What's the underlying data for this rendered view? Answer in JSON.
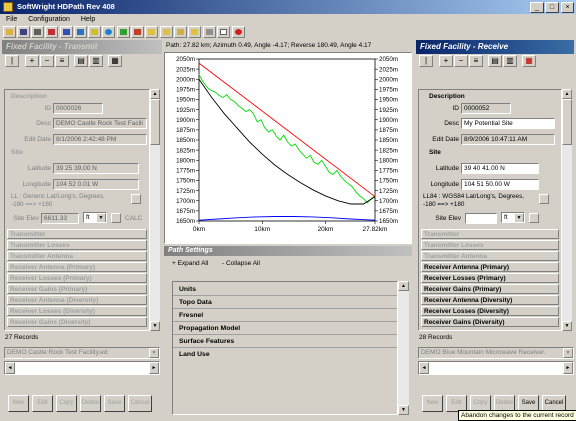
{
  "window": {
    "title": "SoftWright HDPath Rev 408"
  },
  "menu": [
    "File",
    "Configuration",
    "Help"
  ],
  "path_info": "Path: 27.82 km; Azimuth 0.49, Angle -4.17; Reverse 180.49, Angle 4.17",
  "left_panel": {
    "header": "Fixed Facility - Transmit",
    "description_label": "Description",
    "id_label": "ID",
    "id_value": "0000026",
    "desc_label": "Desc",
    "desc_value": "DEMO Castle Rock Test Facili",
    "edit_date_label": "Edit Date",
    "edit_date_value": "8/1/2006 2:42:48 PM",
    "site_label": "Site",
    "latitude_label": "Latitude",
    "latitude_value": "39 25 39.00 N",
    "longitude_label": "Longitude",
    "longitude_value": "104 52 0.01 W",
    "datum_text_1": "LL : Generic Lat/Long's, Degrees,",
    "datum_text_2": "-180 ==> +180",
    "site_elev_label": "Site Elev",
    "site_elev_value": "6611.33",
    "elev_unit": "ft",
    "calc_label": "CALC",
    "sections": [
      "Transmitter",
      "Transmitter Losses",
      "Transmitter Antenna",
      "Receiver Antenna (Primary)",
      "Receiver Losses (Primary)",
      "Receiver Gains (Primary)",
      "Receiver Antenna (Diversity)",
      "Receiver Losses (Diversity)",
      "Receiver Gains (Diversity)"
    ],
    "records": "27 Records",
    "combo_value": "DEMO Castle Rock Test Facility.ed",
    "buttons": [
      "New",
      "Edit",
      "Copy",
      "Delete",
      "Save",
      "Cancel"
    ]
  },
  "right_panel": {
    "header": "Fixed Facility - Receive",
    "description_label": "Description",
    "id_label": "ID",
    "id_value": "0000052",
    "desc_label": "Desc",
    "desc_value": "My Potential Site",
    "edit_date_label": "Edit Date",
    "edit_date_value": "8/9/2006 10:47:11 AM",
    "site_label": "Site",
    "latitude_label": "Latitude",
    "latitude_value": "39 40 41.00 N",
    "longitude_label": "Longitude",
    "longitude_value": "104 51 50.00 W",
    "datum_text_1": "LL84 : WGS84 Lat/Long's, Degrees,",
    "datum_text_2": "-180 ==> +180",
    "site_elev_label": "Site Elev",
    "site_elev_value": "",
    "elev_unit": "ft",
    "sections": [
      "Transmitter",
      "Transmitter Losses",
      "Transmitter Antenna",
      "Receiver Antenna (Primary)",
      "Receiver Losses (Primary)",
      "Receiver Gains (Primary)",
      "Receiver Antenna (Diversity)",
      "Receiver Losses (Diversity)",
      "Receiver Gains (Diversity)"
    ],
    "records": "28 Records",
    "combo_value": "DEMO Blue Mountain Microwave Receiver.",
    "buttons": [
      "New",
      "Edit",
      "Copy",
      "Delete",
      "Save",
      "Cancel"
    ],
    "tooltip": "Abandon changes to the current record"
  },
  "path_settings": {
    "header": "Path Settings",
    "expand_all": "+ Expand All",
    "collapse_all": "- Collapse All",
    "items": [
      "Units",
      "Topo Data",
      "Fresnel",
      "Propagation Model",
      "Surface Features",
      "Land Use"
    ]
  },
  "chart_data": {
    "type": "line",
    "title": "",
    "xlabel": "",
    "ylabel": "",
    "x_ticks": [
      "0km",
      "10km",
      "20km",
      "27.82km"
    ],
    "y_ticks": [
      "2050m",
      "2025m",
      "2000m",
      "1975m",
      "1950m",
      "1925m",
      "1900m",
      "1875m",
      "1850m",
      "1825m",
      "1800m",
      "1775m",
      "1750m",
      "1725m",
      "1700m",
      "1675m",
      "1650m"
    ],
    "xlim": [
      0,
      27.82
    ],
    "ylim": [
      1650,
      2050
    ],
    "series": [
      {
        "color": "#00dd00",
        "x": [
          0,
          0.4,
          0.8,
          1.2,
          1.6,
          2,
          2.6,
          3.2,
          3.8,
          4.4,
          5,
          5.6,
          6.2,
          6.8,
          7.4,
          8,
          8.6,
          9.2,
          9.8,
          10.4,
          11,
          11.6,
          12.2,
          12.8,
          13.4,
          14,
          14.6,
          15.2,
          15.8,
          16.4,
          17,
          17.6,
          18.2,
          18.8,
          19.4,
          20,
          20.6,
          21.2,
          21.8,
          22.4,
          23,
          23.6,
          24.2,
          24.8,
          25.4,
          26,
          26.6,
          27.2,
          27.82
        ],
        "y": [
          2012,
          2000,
          1990,
          1982,
          1975,
          1972,
          1968,
          1960,
          1955,
          1962,
          1950,
          1945,
          1935,
          1928,
          1920,
          1925,
          1915,
          1895,
          1900,
          1880,
          1870,
          1875,
          1860,
          1850,
          1862,
          1845,
          1835,
          1840,
          1825,
          1815,
          1805,
          1812,
          1795,
          1790,
          1800,
          1785,
          1770,
          1765,
          1775,
          1760,
          1750,
          1742,
          1735,
          1722,
          1712,
          1705,
          1695,
          1705,
          1712
        ]
      },
      {
        "color": "#ff0000",
        "x": [
          0,
          27.82
        ],
        "y": [
          2040,
          1710
        ]
      },
      {
        "color": "#000000",
        "x": [
          0,
          2,
          4,
          6,
          8,
          10,
          12,
          14,
          16,
          18,
          20,
          22,
          24,
          26,
          27.82
        ],
        "y": [
          2000,
          1955,
          1915,
          1880,
          1845,
          1815,
          1788,
          1765,
          1745,
          1727,
          1712,
          1700,
          1692,
          1692,
          1710
        ]
      },
      {
        "color": "#0000ff",
        "x": [
          0,
          3,
          6,
          9,
          12,
          15,
          18,
          21,
          24,
          27.82
        ],
        "y": [
          1652,
          1655,
          1658,
          1660,
          1661,
          1661,
          1660,
          1658,
          1655,
          1652
        ]
      }
    ],
    "grid": false
  }
}
